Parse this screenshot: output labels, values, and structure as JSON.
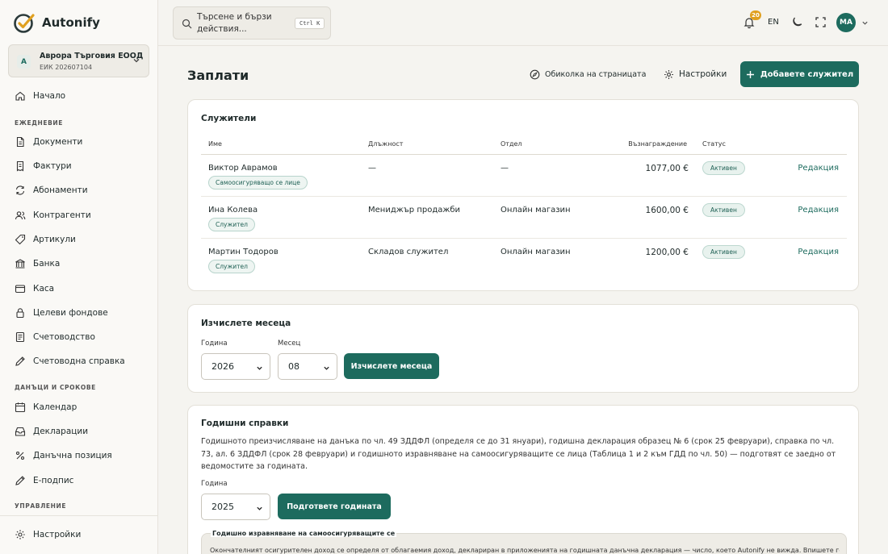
{
  "brand": {
    "name": "Autonify"
  },
  "org": {
    "initial": "A",
    "name": "Аврора Търговия ЕООД",
    "eik": "ЕИК 202607104"
  },
  "search": {
    "placeholder": "Търсене и бързи действия...",
    "shortcut": "Ctrl K"
  },
  "topbar": {
    "notifications_count": "20",
    "language": "EN",
    "avatar_initials": "МА"
  },
  "sidebar": {
    "home": "Начало",
    "section_daily": "ЕЖЕДНЕВИЕ",
    "daily": [
      "Документи",
      "Фактури",
      "Абонаменти",
      "Контрагенти",
      "Артикули",
      "Банка",
      "Каса",
      "Целеви фондове",
      "Счетоводство",
      "Счетоводна справка"
    ],
    "section_taxes": "ДАНЪЦИ И СРОКОВЕ",
    "taxes": [
      "Календар",
      "Декларации",
      "Данъчна позиция",
      "Е-подпис"
    ],
    "section_manage": "УПРАВЛЕНИЕ",
    "settings": "Настройки"
  },
  "page": {
    "title": "Заплати",
    "tour_label": "Обиколка на страницата",
    "settings_label": "Настройки",
    "add_label": "Добавете служител"
  },
  "employees": {
    "title": "Служители",
    "columns": [
      "Име",
      "Длъжност",
      "Отдел",
      "Възнаграждение",
      "Статус"
    ],
    "edit_label": "Редакция",
    "rows": [
      {
        "name": "Виктор Аврамов",
        "tag": "Самоосигуряващо се лице",
        "position": "—",
        "department": "—",
        "salary": "1077,00 €",
        "status": "Активен"
      },
      {
        "name": "Ина Колева",
        "tag": "Служител",
        "position": "Мениджър продажби",
        "department": "Онлайн магазин",
        "salary": "1600,00 €",
        "status": "Активен"
      },
      {
        "name": "Мартин Тодоров",
        "tag": "Служител",
        "position": "Складов служител",
        "department": "Онлайн магазин",
        "salary": "1200,00 €",
        "status": "Активен"
      }
    ]
  },
  "month_calc": {
    "title": "Изчислете месеца",
    "year_label": "Година",
    "year_value": "2026",
    "month_label": "Месец",
    "month_value": "08",
    "button": "Изчислете месеца"
  },
  "annual": {
    "title": "Годишни справки",
    "description": "Годишното преизчисляване на данъка по чл. 49 ЗДДФЛ (определя се до 31 януари), годишна декларация образец № 6 (срок 25 февруари), справка по чл. 73, ал. 6 ЗДДФЛ (срок 28 февруари) и годишното изравняване на самоосигуряващите се лица (Таблица 1 и 2 към ГДД по чл. 50) — подготвят се заедно от ведомостите за годината.",
    "year_label": "Година",
    "year_value": "2025",
    "button": "Подгответе годината",
    "box_label": "Годишно изравняване на самоосигуряващите се",
    "box_text": "Окончателният осигурителен доход се определя от облагаемия доход, деклариран в приложенията на годишната данъчна декларация — число, което Autonify не вижда. Впишете го"
  }
}
